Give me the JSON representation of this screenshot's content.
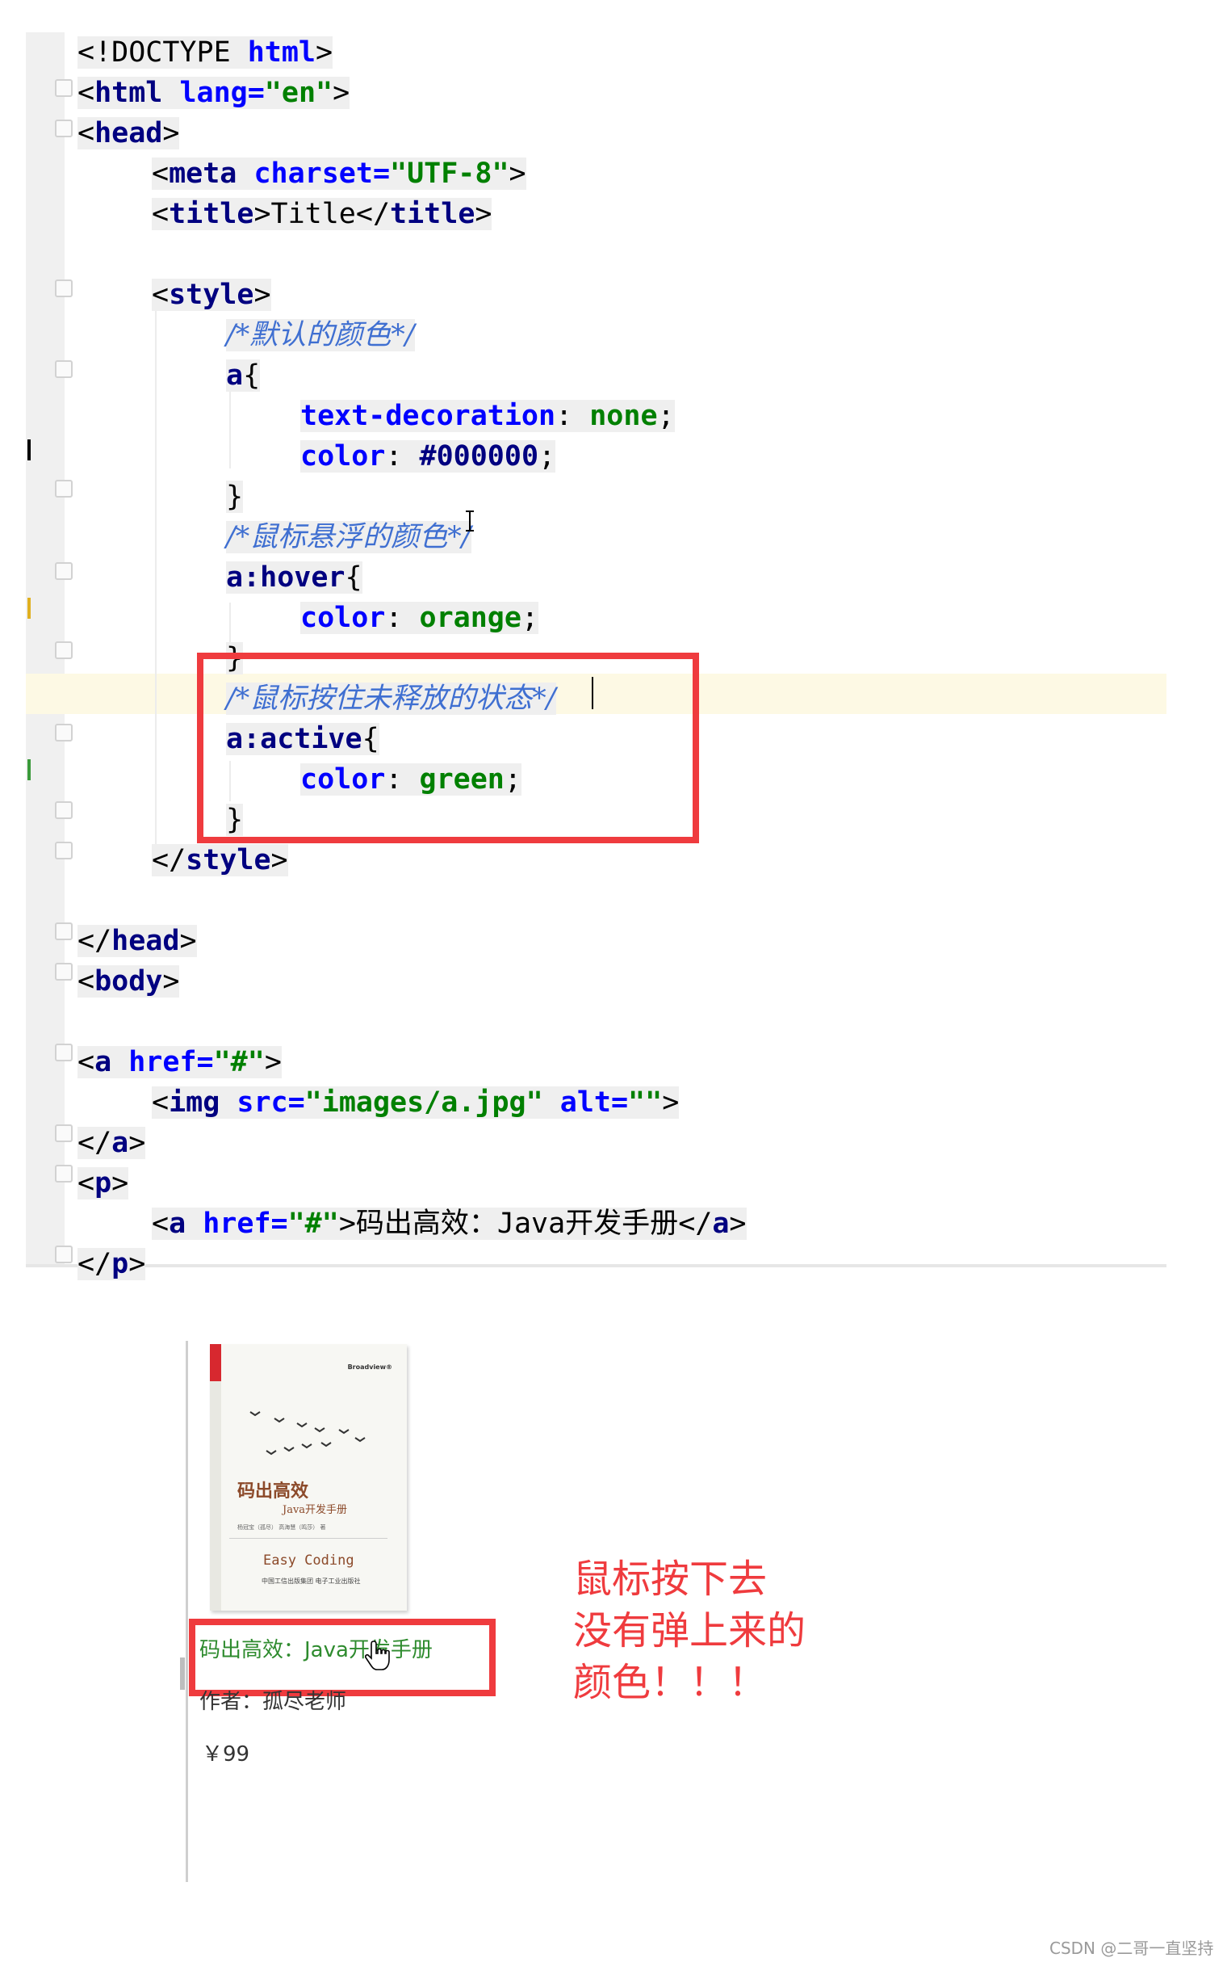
{
  "editor": {
    "lines": [
      {
        "indent": 0,
        "tokens": [
          {
            "t": "<!DOCTYPE ",
            "c": "punct"
          },
          {
            "t": "html",
            "c": "attr"
          },
          {
            "t": ">",
            "c": "punct"
          }
        ]
      },
      {
        "indent": 0,
        "tokens": [
          {
            "t": "<",
            "c": "punct"
          },
          {
            "t": "html ",
            "c": "tag"
          },
          {
            "t": "lang=",
            "c": "attr"
          },
          {
            "t": "\"en\"",
            "c": "str"
          },
          {
            "t": ">",
            "c": "punct"
          }
        ]
      },
      {
        "indent": 0,
        "tokens": [
          {
            "t": "<",
            "c": "punct"
          },
          {
            "t": "head",
            "c": "tag"
          },
          {
            "t": ">",
            "c": "punct"
          }
        ]
      },
      {
        "indent": 1,
        "tokens": [
          {
            "t": "<",
            "c": "punct"
          },
          {
            "t": "meta ",
            "c": "tag"
          },
          {
            "t": "charset=",
            "c": "attr"
          },
          {
            "t": "\"UTF-8\"",
            "c": "str"
          },
          {
            "t": ">",
            "c": "punct"
          }
        ]
      },
      {
        "indent": 1,
        "tokens": [
          {
            "t": "<",
            "c": "punct"
          },
          {
            "t": "title",
            "c": "tag"
          },
          {
            "t": ">",
            "c": "punct"
          },
          {
            "t": "Title",
            "c": "text"
          },
          {
            "t": "</",
            "c": "punct"
          },
          {
            "t": "title",
            "c": "tag"
          },
          {
            "t": ">",
            "c": "punct"
          }
        ]
      },
      {
        "indent": 0,
        "tokens": []
      },
      {
        "indent": 1,
        "tokens": [
          {
            "t": "<",
            "c": "punct"
          },
          {
            "t": "style",
            "c": "tag"
          },
          {
            "t": ">",
            "c": "punct"
          }
        ]
      },
      {
        "indent": 2,
        "tokens": [
          {
            "t": "/*默认的颜色*/",
            "c": "cmt"
          }
        ]
      },
      {
        "indent": 2,
        "tokens": [
          {
            "t": "a",
            "c": "sel"
          },
          {
            "t": "{",
            "c": "punct"
          }
        ]
      },
      {
        "indent": 3,
        "tokens": [
          {
            "t": "text-decoration",
            "c": "prop"
          },
          {
            "t": ": ",
            "c": "punct"
          },
          {
            "t": "none",
            "c": "val"
          },
          {
            "t": ";",
            "c": "punct"
          }
        ]
      },
      {
        "indent": 3,
        "tokens": [
          {
            "t": "color",
            "c": "prop"
          },
          {
            "t": ": ",
            "c": "punct"
          },
          {
            "t": "#000000",
            "c": "sel"
          },
          {
            "t": ";",
            "c": "punct"
          }
        ]
      },
      {
        "indent": 2,
        "tokens": [
          {
            "t": "}",
            "c": "punct"
          }
        ]
      },
      {
        "indent": 2,
        "tokens": [
          {
            "t": "/*鼠标悬浮的颜色*/",
            "c": "cmt"
          }
        ]
      },
      {
        "indent": 2,
        "tokens": [
          {
            "t": "a",
            "c": "sel"
          },
          {
            "t": ":hover",
            "c": "sel"
          },
          {
            "t": "{",
            "c": "punct"
          }
        ]
      },
      {
        "indent": 3,
        "tokens": [
          {
            "t": "color",
            "c": "prop"
          },
          {
            "t": ": ",
            "c": "punct"
          },
          {
            "t": "orange",
            "c": "val"
          },
          {
            "t": ";",
            "c": "punct"
          }
        ]
      },
      {
        "indent": 2,
        "tokens": [
          {
            "t": "}",
            "c": "punct"
          }
        ]
      },
      {
        "indent": 2,
        "tokens": [
          {
            "t": "/*鼠标按住未释放的状态*/",
            "c": "cmt"
          }
        ]
      },
      {
        "indent": 2,
        "tokens": [
          {
            "t": "a",
            "c": "sel"
          },
          {
            "t": ":active",
            "c": "sel"
          },
          {
            "t": "{",
            "c": "punct"
          }
        ]
      },
      {
        "indent": 3,
        "tokens": [
          {
            "t": "color",
            "c": "prop"
          },
          {
            "t": ": ",
            "c": "punct"
          },
          {
            "t": "green",
            "c": "val"
          },
          {
            "t": ";",
            "c": "punct"
          }
        ]
      },
      {
        "indent": 2,
        "tokens": [
          {
            "t": "}",
            "c": "punct"
          }
        ]
      },
      {
        "indent": 1,
        "tokens": [
          {
            "t": "</",
            "c": "punct"
          },
          {
            "t": "style",
            "c": "tag"
          },
          {
            "t": ">",
            "c": "punct"
          }
        ]
      },
      {
        "indent": 0,
        "tokens": []
      },
      {
        "indent": 0,
        "tokens": [
          {
            "t": "</",
            "c": "punct"
          },
          {
            "t": "head",
            "c": "tag"
          },
          {
            "t": ">",
            "c": "punct"
          }
        ]
      },
      {
        "indent": 0,
        "tokens": [
          {
            "t": "<",
            "c": "punct"
          },
          {
            "t": "body",
            "c": "tag"
          },
          {
            "t": ">",
            "c": "punct"
          }
        ]
      },
      {
        "indent": 0,
        "tokens": []
      },
      {
        "indent": 0,
        "tokens": [
          {
            "t": "<",
            "c": "punct"
          },
          {
            "t": "a ",
            "c": "tag"
          },
          {
            "t": "href=",
            "c": "attr"
          },
          {
            "t": "\"#\"",
            "c": "str"
          },
          {
            "t": ">",
            "c": "punct"
          }
        ]
      },
      {
        "indent": 1,
        "tokens": [
          {
            "t": "<",
            "c": "punct"
          },
          {
            "t": "img ",
            "c": "tag"
          },
          {
            "t": "src=",
            "c": "attr"
          },
          {
            "t": "\"images/a.jpg\" ",
            "c": "str"
          },
          {
            "t": "alt=",
            "c": "attr"
          },
          {
            "t": "\"\"",
            "c": "str"
          },
          {
            "t": ">",
            "c": "punct"
          }
        ]
      },
      {
        "indent": 0,
        "tokens": [
          {
            "t": "</",
            "c": "punct"
          },
          {
            "t": "a",
            "c": "tag"
          },
          {
            "t": ">",
            "c": "punct"
          }
        ]
      },
      {
        "indent": 0,
        "tokens": [
          {
            "t": "<",
            "c": "punct"
          },
          {
            "t": "p",
            "c": "tag"
          },
          {
            "t": ">",
            "c": "punct"
          }
        ]
      },
      {
        "indent": 1,
        "tokens": [
          {
            "t": "<",
            "c": "punct"
          },
          {
            "t": "a ",
            "c": "tag"
          },
          {
            "t": "href=",
            "c": "attr"
          },
          {
            "t": "\"#\"",
            "c": "str"
          },
          {
            "t": ">",
            "c": "punct"
          },
          {
            "t": "码出高效：Java开发手册",
            "c": "text"
          },
          {
            "t": "</",
            "c": "punct"
          },
          {
            "t": "a",
            "c": "tag"
          },
          {
            "t": ">",
            "c": "punct"
          }
        ]
      },
      {
        "indent": 0,
        "tokens": [
          {
            "t": "</",
            "c": "punct"
          },
          {
            "t": "p",
            "c": "tag"
          },
          {
            "t": ">",
            "c": "punct"
          }
        ]
      }
    ]
  },
  "preview": {
    "book": {
      "publisher": "Broadview®",
      "title": "码出高效",
      "subtitle": "Java开发手册",
      "authors": "杨冠宝（孤尽） 高海慧（鸣莎） 著",
      "motto": "Easy Coding",
      "press": "中国工信出版集团  电子工业出版社"
    },
    "link_text": "码出高效：Java开发手册",
    "author_line": "作者：孤尽老师",
    "price_line": "￥99"
  },
  "annotation": {
    "lines": [
      "鼠标按下去",
      "没有弹上来的",
      "颜色！！！"
    ]
  },
  "watermark": "CSDN @二哥一直坚持",
  "colors": {
    "highlight_box": "#ef3b3e",
    "active_link": "#2e8b2e",
    "comment": "#3f6fd1"
  }
}
